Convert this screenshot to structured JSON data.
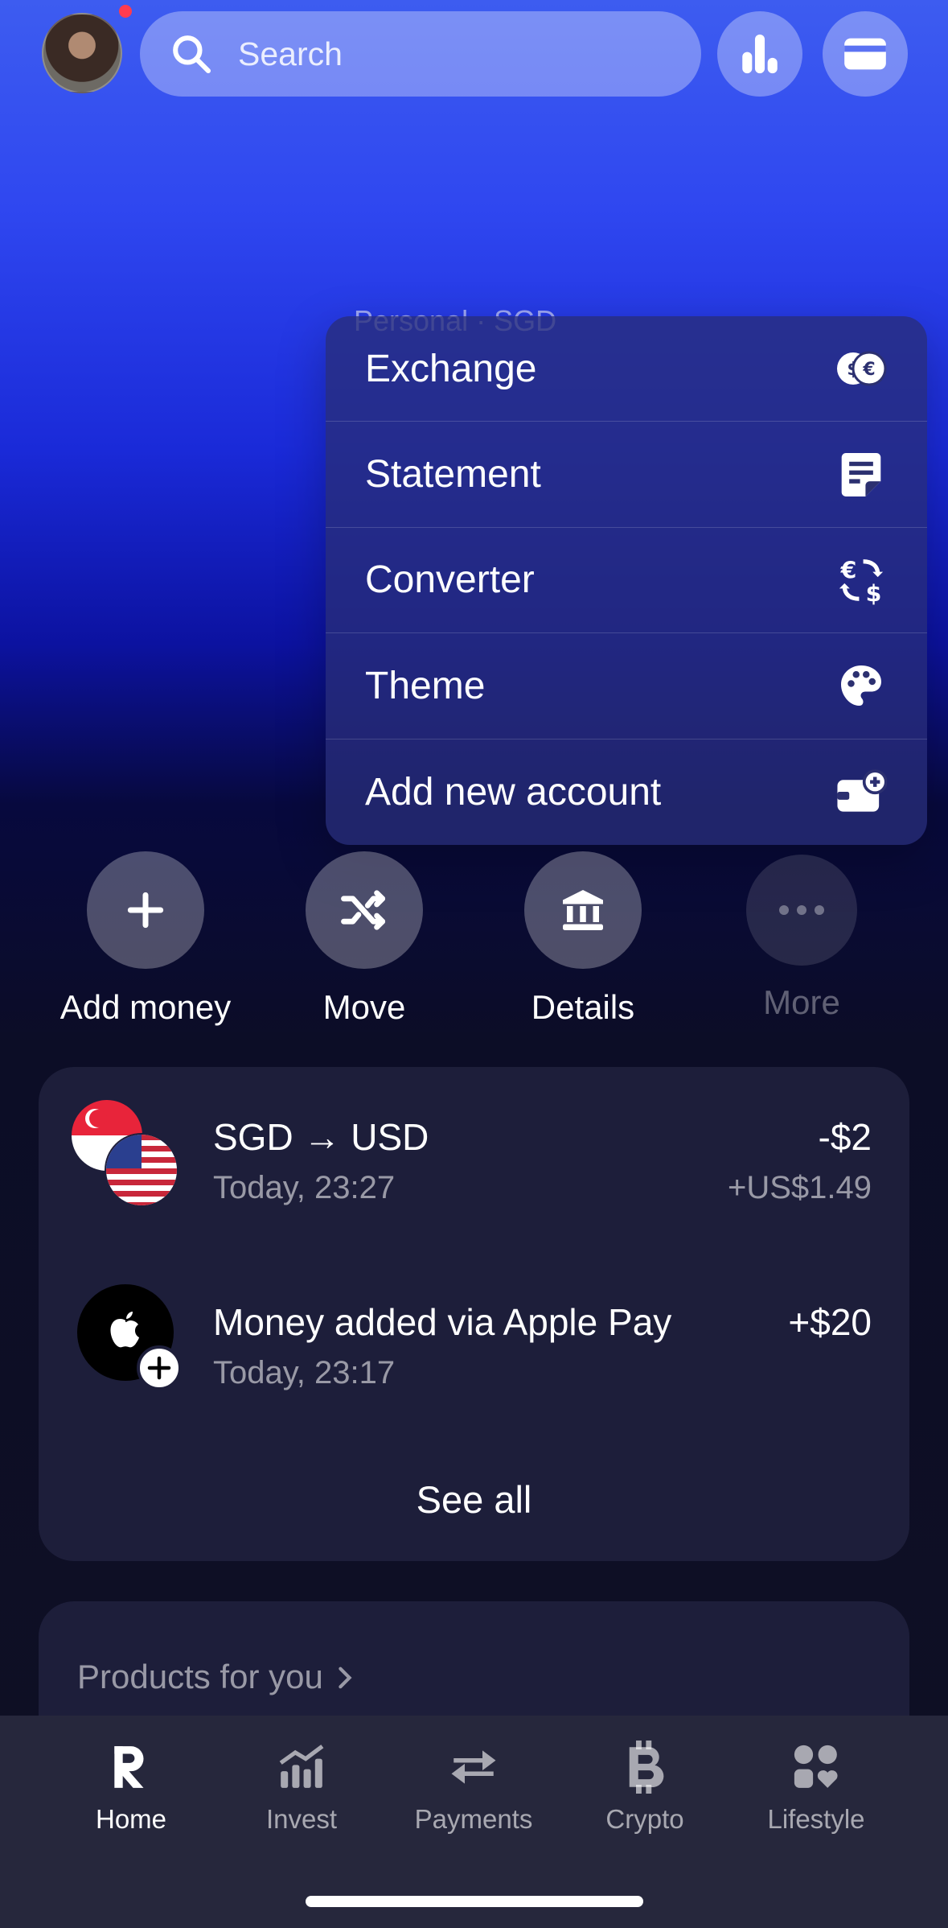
{
  "header": {
    "search_placeholder": "Search"
  },
  "balance_hint": "Personal · SGD",
  "menu": {
    "items": [
      {
        "label": "Exchange",
        "icon": "exchange-icon"
      },
      {
        "label": "Statement",
        "icon": "statement-icon"
      },
      {
        "label": "Converter",
        "icon": "converter-icon"
      },
      {
        "label": "Theme",
        "icon": "palette-icon"
      },
      {
        "label": "Add new account",
        "icon": "add-account-icon"
      }
    ]
  },
  "actions": [
    {
      "label": "Add money",
      "icon": "plus-icon"
    },
    {
      "label": "Move",
      "icon": "shuffle-icon"
    },
    {
      "label": "Details",
      "icon": "bank-icon"
    },
    {
      "label": "More",
      "icon": "more-icon"
    }
  ],
  "transactions": [
    {
      "title": "SGD → USD",
      "subtitle": "Today, 23:27",
      "amount": "-$2",
      "amount_secondary": "+US$1.49",
      "icon": "sg-us-flags-icon"
    },
    {
      "title": "Money added via Apple Pay",
      "subtitle": "Today, 23:17",
      "amount": "+$20",
      "icon": "apple-pay-icon"
    }
  ],
  "see_all": "See all",
  "products": {
    "label": "Products for you"
  },
  "tabs": [
    {
      "label": "Home",
      "icon": "revolut-logo-icon",
      "active": true
    },
    {
      "label": "Invest",
      "icon": "invest-chart-icon",
      "active": false
    },
    {
      "label": "Payments",
      "icon": "transfer-arrows-icon",
      "active": false
    },
    {
      "label": "Crypto",
      "icon": "bitcoin-icon",
      "active": false
    },
    {
      "label": "Lifestyle",
      "icon": "lifestyle-icon",
      "active": false
    }
  ],
  "colors": {
    "accent_blue": "#2f47f0",
    "notification_dot": "#ff3b4e",
    "card_bg": "#1d1e3a"
  }
}
